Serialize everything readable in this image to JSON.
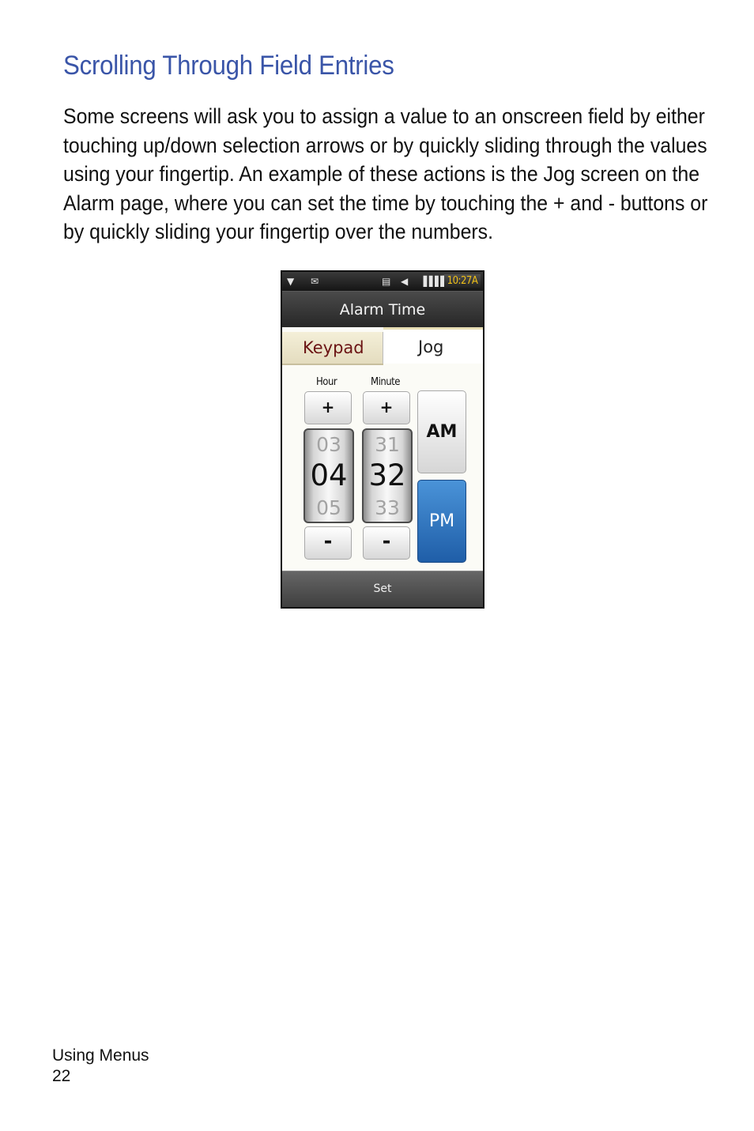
{
  "section_heading": "Scrolling Through Field Entries",
  "paragraph_lines": [
    "Some screens will ask you to assign a value to an onscreen field by either",
    "touching up/down selection arrows or by quickly sliding through the values",
    "using your fingertip. An example of these actions is the Jog screen on the",
    "Alarm page, where you can set the time by touching the + and - buttons or",
    "by quickly sliding your fingertip over the numbers."
  ],
  "phone": {
    "status_time": "10:27A",
    "status_icons": [
      "signal-icon",
      "message-icon",
      "sync-icon",
      "volume-icon",
      "battery-icon"
    ],
    "title": "Alarm Time",
    "tabs": {
      "keypad": "Keypad",
      "jog": "Jog"
    },
    "hour": {
      "label": "Hour",
      "plus": "+",
      "minus": "-",
      "prev": "03",
      "current": "04",
      "next": "05"
    },
    "minute": {
      "label": "Minute",
      "plus": "+",
      "minus": "-",
      "prev": "31",
      "current": "32",
      "next": "33"
    },
    "am_label": "AM",
    "pm_label": "PM",
    "selected_period": "PM",
    "softkey": "Set",
    "colors": {
      "accent_blue": "#2a6fbd",
      "clock_yellow": "#f0c018",
      "keypad_tab_text": "#6b1414"
    }
  },
  "footer": {
    "section": "Using Menus",
    "page": "22"
  }
}
